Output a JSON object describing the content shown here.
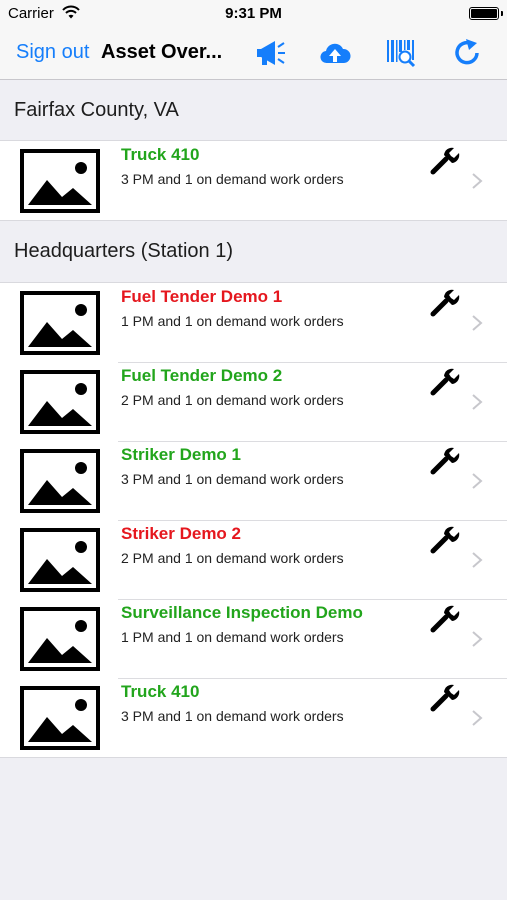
{
  "status_bar": {
    "carrier": "Carrier",
    "time": "9:31 PM",
    "battery_level": 1.0
  },
  "nav": {
    "sign_out_label": "Sign out",
    "title": "Asset Over...",
    "icons": [
      "megaphone-icon",
      "cloud-upload-icon",
      "barcode-scan-icon",
      "refresh-icon"
    ]
  },
  "colors": {
    "accent": "#157efb",
    "status_ok": "#22a51c",
    "status_alert": "#e5171e",
    "background": "#efeff4"
  },
  "sections": [
    {
      "title": "Fairfax County, VA",
      "items": [
        {
          "name": "Truck 410",
          "status": "ok",
          "work_orders": "3 PM and 1 on demand work orders"
        }
      ]
    },
    {
      "title": "Headquarters (Station 1)",
      "items": [
        {
          "name": "Fuel Tender Demo 1",
          "status": "alert",
          "work_orders": "1 PM and 1 on demand work orders"
        },
        {
          "name": "Fuel Tender Demo 2",
          "status": "ok",
          "work_orders": "2 PM and 1 on demand work orders"
        },
        {
          "name": "Striker Demo 1",
          "status": "ok",
          "work_orders": "3 PM and 1 on demand work orders"
        },
        {
          "name": "Striker Demo 2",
          "status": "alert",
          "work_orders": "2 PM and 1 on demand work orders"
        },
        {
          "name": "Surveillance Inspection Demo",
          "status": "ok",
          "work_orders": "1 PM and 1 on demand work orders"
        },
        {
          "name": "Truck 410",
          "status": "ok",
          "work_orders": "3 PM and 1 on demand work orders"
        }
      ]
    }
  ]
}
